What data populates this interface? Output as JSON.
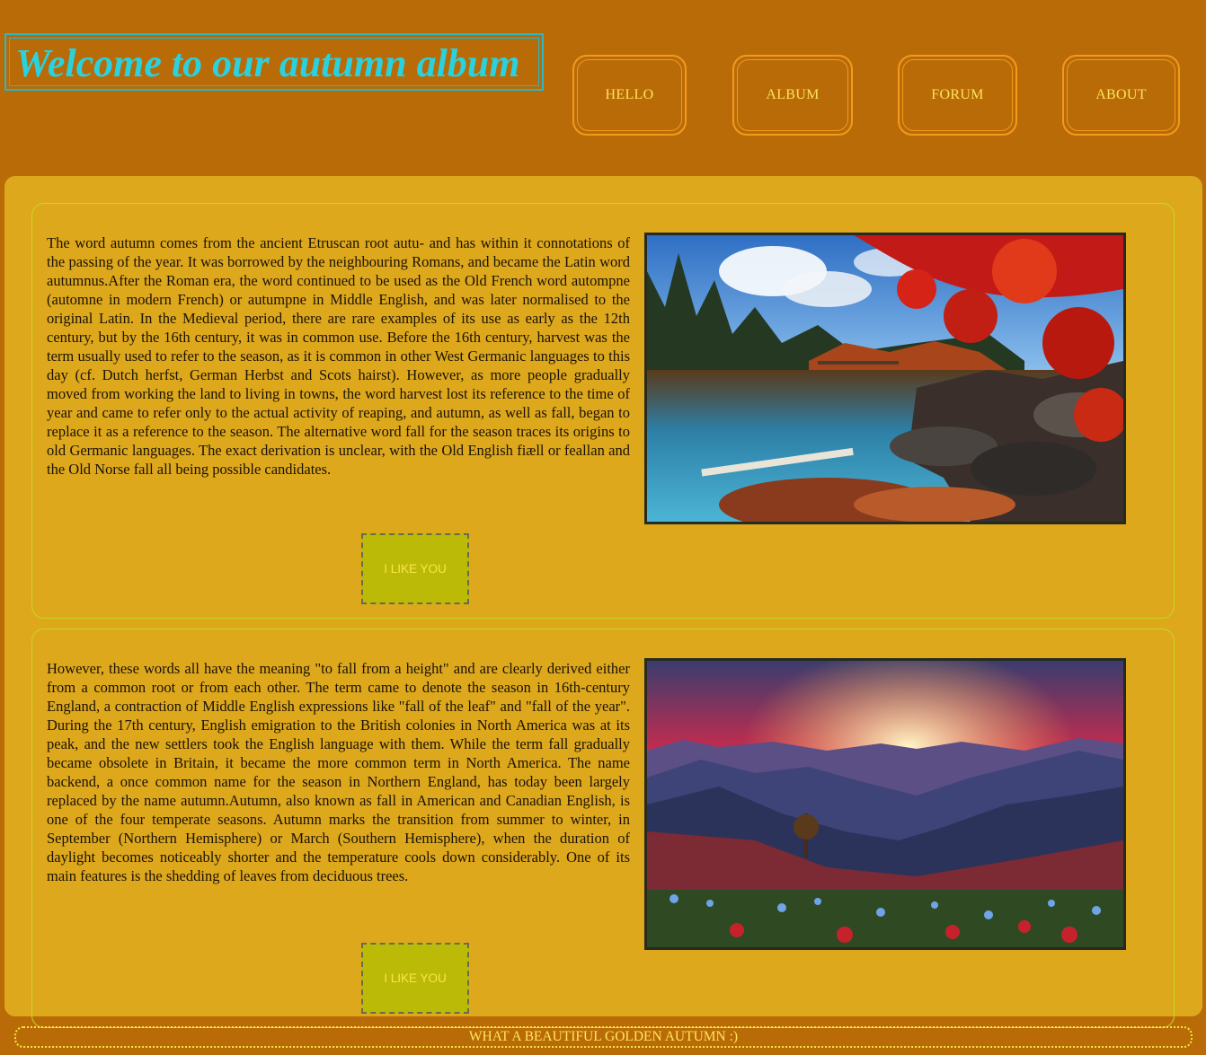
{
  "header": {
    "title": "Welcome to our autumn album",
    "nav": [
      "HELLO",
      "ALBUM",
      "FORUM",
      "ABOUT"
    ]
  },
  "sections": [
    {
      "text": "The word autumn comes from the ancient Etruscan root autu- and has within it connotations of the passing of the year. It was borrowed by the neighbouring Romans, and became the Latin word autumnus.After the Roman era, the word continued to be used as the Old French word autompne (automne in modern French) or autumpne in Middle English, and was later normalised to the original Latin. In the Medieval period, there are rare examples of its use as early as the 12th century, but by the 16th century, it was in common use. Before the 16th century, harvest was the term usually used to refer to the season, as it is common in other West Germanic languages to this day (cf. Dutch herfst, German Herbst and Scots hairst). However, as more people gradually moved from working the land to living in towns, the word harvest lost its reference to the time of year and came to refer only to the actual activity of reaping, and autumn, as well as fall, began to replace it as a reference to the season. The alternative word fall for the season traces its origins to old Germanic languages. The exact derivation is unclear, with the Old English fiæll or feallan and the Old Norse fall all being possible candidates.",
      "button": "I LIKE YOU",
      "image": "autumn-lake-photo"
    },
    {
      "text": "However, these words all have the meaning \"to fall from a height\" and are clearly derived either from a common root or from each other. The term came to denote the season in 16th-century England, a contraction of Middle English expressions like \"fall of the leaf\" and \"fall of the year\". During the 17th century, English emigration to the British colonies in North America was at its peak, and the new settlers took the English language with them. While the term fall gradually became obsolete in Britain, it became the more common term in North America. The name backend, a once common name for the season in Northern England, has today been largely replaced by the name autumn.Autumn, also known as fall in American and Canadian English, is one of the four temperate seasons. Autumn marks the transition from summer to winter, in September (Northern Hemisphere) or March (Southern Hemisphere), when the duration of daylight becomes noticeably shorter and the temperature cools down considerably. One of its main features is the shedding of leaves from deciduous trees.",
      "button": "I LIKE YOU",
      "image": "mountain-sunset-photo"
    }
  ],
  "footer": "WHAT A BEAUTIFUL GOLDEN AUTUMN :)",
  "colors": {
    "page_bg": "#b96b07",
    "content_bg": "#dea81d",
    "title": "#2ad1de",
    "nav_text": "#ffe35a",
    "nav_border": "#f29a1c",
    "button_bg": "#bbba06"
  }
}
